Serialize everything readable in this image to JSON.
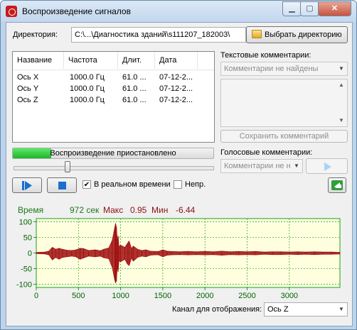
{
  "window": {
    "title": "Воспроизведение сигналов",
    "minimize": "▁",
    "maximize": "▢",
    "close": "✕"
  },
  "directory": {
    "label": "Директория:",
    "path": "C:\\...\\Диагностика зданий\\s111207_182003\\",
    "button": "Выбрать директорию"
  },
  "signals": {
    "columns": [
      "Название",
      "Частота",
      "Длит.",
      "Дата"
    ],
    "rows": [
      [
        "Ось X",
        "1000.0 Гц",
        "61.0 ...",
        "07-12-2..."
      ],
      [
        "Ось Y",
        "1000.0 Гц",
        "61.0 ...",
        "07-12-2..."
      ],
      [
        "Ось Z",
        "1000.0 Гц",
        "61.0 ...",
        "07-12-2..."
      ]
    ]
  },
  "text_comments": {
    "label": "Текстовые комментарии:",
    "selected": "Комментарии не найдены",
    "save_button": "Сохранить комментарий"
  },
  "voice_comments": {
    "label": "Голосовые комментарии:",
    "selected": "Комментарии не н"
  },
  "playback": {
    "status": "Воспроизведение приостановлено",
    "progress": 0.19,
    "position": 0.27,
    "realtime_label": "В реальном времени",
    "realtime_checked": true,
    "continuous_label": "Непр.",
    "continuous_checked": false
  },
  "stats": {
    "time_label": "Время",
    "time_value": "972 сек",
    "max_label": "Макс",
    "max_value": "0.95",
    "min_label": "Мин",
    "min_value": "-6.44"
  },
  "channel": {
    "label": "Канал для отображения:",
    "selected": "Ось Z"
  },
  "colors": {
    "plot_bg": "#ffffe0",
    "grid": "#19a019",
    "signal": "#a01010",
    "axis_text": "#006400",
    "stats_time": "#1a7a1a",
    "stats_minmax": "#8b1010"
  },
  "chart_data": {
    "type": "line",
    "x_ticks": [
      0,
      500,
      1000,
      1500,
      2000,
      2500,
      3000
    ],
    "y_ticks": [
      100,
      50,
      0,
      -50,
      -100
    ],
    "xlim": [
      0,
      3600
    ],
    "ylim": [
      -110,
      110
    ],
    "grid": true,
    "series": [
      {
        "x": [
          0,
          100,
          150,
          190,
          230,
          270,
          310,
          360,
          420,
          470,
          520,
          560,
          620,
          700,
          760,
          800,
          860,
          900,
          930,
          940,
          950,
          960,
          970,
          980,
          1000,
          1050,
          1080,
          1100,
          1130,
          1150,
          1200,
          1250,
          1300,
          1350,
          1400,
          1450,
          1500,
          1550,
          1600,
          1700,
          1800,
          1900,
          2000,
          2100,
          2200,
          2300,
          2400,
          2500,
          2600,
          2700,
          2800,
          2900,
          3000,
          3100,
          3200,
          3300,
          3400,
          3500,
          3600
        ],
        "y_max": [
          2,
          3,
          6,
          18,
          12,
          15,
          12,
          9,
          8,
          10,
          15,
          14,
          8,
          10,
          7,
          12,
          16,
          40,
          80,
          95,
          82,
          38,
          55,
          20,
          25,
          18,
          30,
          38,
          14,
          22,
          12,
          8,
          10,
          6,
          5,
          5,
          10,
          6,
          5,
          4,
          5,
          4,
          5,
          4,
          6,
          4,
          5,
          4,
          5,
          3,
          4,
          4,
          3,
          4,
          3,
          4,
          3,
          3,
          2
        ],
        "y_min": [
          -2,
          -3,
          -6,
          -22,
          -14,
          -20,
          -14,
          -12,
          -10,
          -12,
          -20,
          -16,
          -10,
          -12,
          -10,
          -15,
          -18,
          -45,
          -85,
          -95,
          -90,
          -42,
          -60,
          -25,
          -28,
          -20,
          -35,
          -40,
          -16,
          -26,
          -14,
          -10,
          -12,
          -7,
          -6,
          -6,
          -12,
          -7,
          -6,
          -5,
          -6,
          -5,
          -6,
          -5,
          -7,
          -5,
          -6,
          -5,
          -6,
          -4,
          -5,
          -5,
          -4,
          -5,
          -4,
          -5,
          -4,
          -4,
          -3
        ]
      }
    ]
  }
}
